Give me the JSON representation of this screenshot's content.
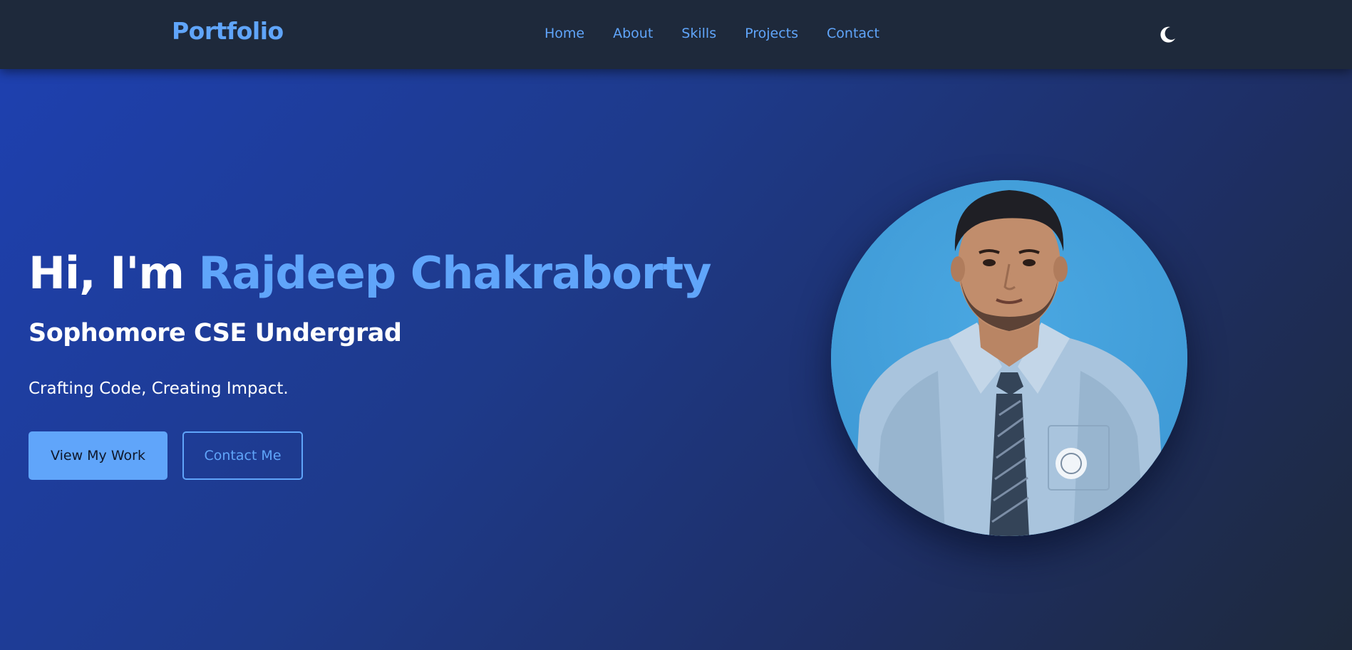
{
  "navbar": {
    "brand": "Portfolio",
    "links": [
      {
        "label": "Home"
      },
      {
        "label": "About"
      },
      {
        "label": "Skills"
      },
      {
        "label": "Projects"
      },
      {
        "label": "Contact"
      }
    ],
    "theme_toggle_icon": "moon-icon"
  },
  "hero": {
    "greeting": "Hi, I'm",
    "name": "Rajdeep Chakraborty",
    "subtitle": "Sophomore CSE Undergrad",
    "tagline": "Crafting Code, Creating Impact.",
    "primary_button": "View My Work",
    "secondary_button": "Contact Me"
  },
  "colors": {
    "accent": "#60a5fa",
    "navbar_bg": "#1e293b",
    "hero_gradient_start": "#1e40af",
    "hero_gradient_end": "#1e293b"
  }
}
